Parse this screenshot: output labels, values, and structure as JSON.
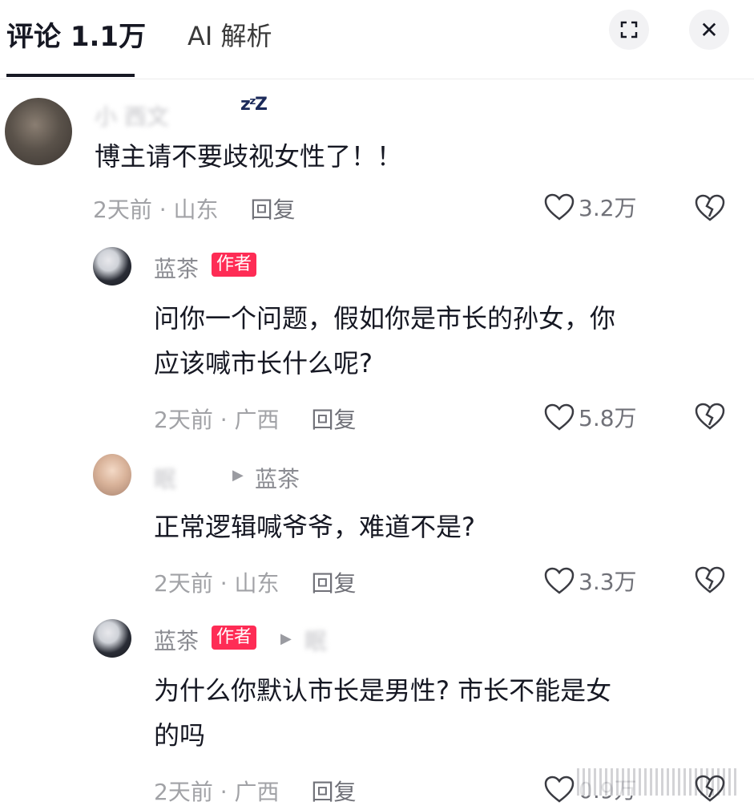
{
  "header": {
    "comments_tab": "评论 1.1万",
    "ai_tab": "AI 解析",
    "close_glyph": "✕"
  },
  "comments": [
    {
      "name": "小 西文",
      "text": "博主请不要歧视女性了！！",
      "meta": "2天前 · 山东",
      "reply": "回复",
      "likes": "3.2万"
    },
    {
      "name": "蓝茶",
      "badge": "作者",
      "text_lines": [
        "问你一个问题，假如你是市长的孙女，你",
        "应该喊市长什么呢?"
      ],
      "meta": "2天前 · 广西",
      "reply": "回复",
      "likes": "5.8万"
    },
    {
      "name": "眠",
      "reply_to": "蓝茶",
      "text": "正常逻辑喊爷爷，难道不是?",
      "meta": "2天前 · 山东",
      "reply": "回复",
      "likes": "3.3万"
    },
    {
      "name": "蓝茶",
      "badge": "作者",
      "reply_to": "眠",
      "text_lines": [
        "为什么你默认市长是男性? 市长不能是女",
        "的吗"
      ],
      "meta": "2天前 · 广西",
      "reply": "回复",
      "likes": "0.9万"
    }
  ],
  "zzz": "zᶻZ"
}
